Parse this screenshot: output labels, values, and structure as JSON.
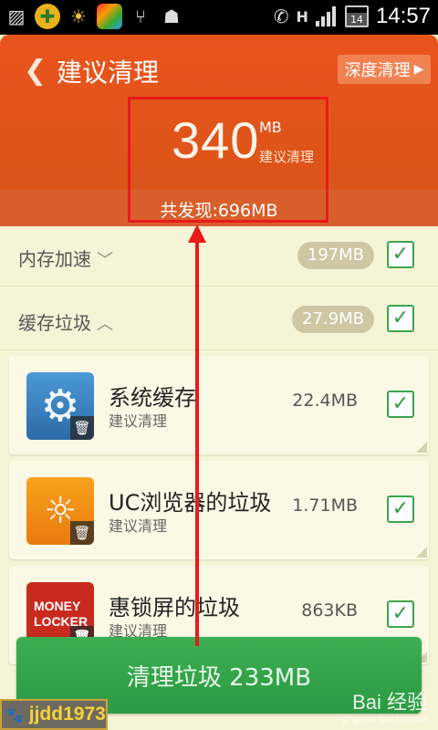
{
  "status_bar": {
    "time": "14:57",
    "battery": "14",
    "icons": [
      "photo-icon",
      "plus-circle-icon",
      "weather-icon",
      "app-store-icon",
      "usb-icon",
      "android-icon",
      "phone-icon",
      "network-h-icon",
      "signal-icon",
      "battery-icon"
    ]
  },
  "header": {
    "title": "建议清理",
    "deep_clean_label": "深度清理",
    "amount_value": "340",
    "amount_unit": "MB",
    "amount_caption": "建议清理",
    "total_found": "共发现:696MB"
  },
  "sections": [
    {
      "label": "内存加速",
      "size": "197MB",
      "expanded": false,
      "checked": true
    },
    {
      "label": "缓存垃圾",
      "size": "27.9MB",
      "expanded": true,
      "checked": true
    }
  ],
  "items": [
    {
      "title": "系统缓存",
      "subtitle": "建议清理",
      "size": "22.4MB",
      "icon": "gear-icon",
      "checked": true
    },
    {
      "title": "UC浏览器的垃圾",
      "subtitle": "建议清理",
      "size": "1.71MB",
      "icon": "uc-browser-icon",
      "checked": true
    },
    {
      "title": "惠锁屏的垃圾",
      "subtitle": "建议清理",
      "size": "863KB",
      "icon": "money-locker-icon",
      "icon_text": "MONEY LOCKER",
      "checked": true
    }
  ],
  "clean_button": "清理垃圾 233MB",
  "watermark": {
    "user": "jjdd1973",
    "brand": "Bai  经验",
    "url": "jingyan.baidu.com"
  },
  "colors": {
    "header": "#e2541b",
    "highlight": "#ea1a1a",
    "accent_green": "#33a44b",
    "background": "#f6f4d6"
  }
}
